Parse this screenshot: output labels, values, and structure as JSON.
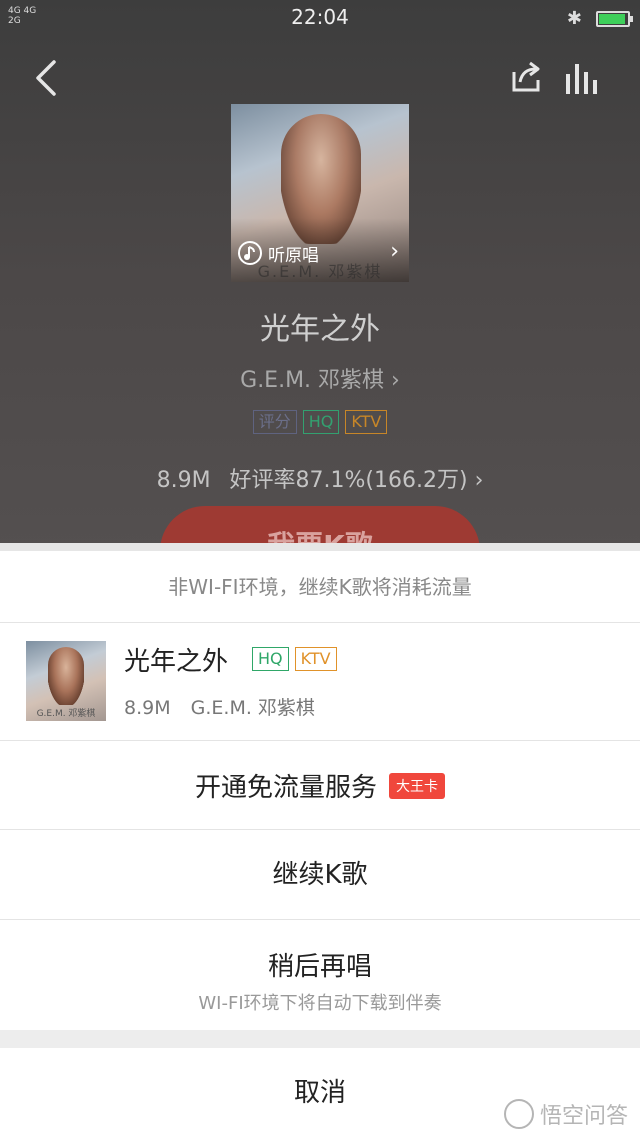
{
  "status_bar": {
    "network_left": "4G 4G",
    "network_left2": "2G",
    "time": "22:04",
    "battery_level": 0.85,
    "battery_color": "#3ecf5a"
  },
  "nav": {
    "back_icon": "chevron-left-icon",
    "share_icon": "share-icon",
    "equalizer_icon": "equalizer-icon"
  },
  "song": {
    "cover_caption": "G.E.M. 邓紫棋",
    "listen_label": "听原唱",
    "title": "光年之外",
    "artist": "G.E.M. 邓紫棋",
    "tags": [
      "评分",
      "HQ",
      "KTV"
    ],
    "plays": "8.9M",
    "rating": "好评率87.1%(166.2万)",
    "sing_button": "我要K歌"
  },
  "sheet": {
    "notice": "非WI-FI环境，继续K歌将消耗流量",
    "card": {
      "title": "光年之外",
      "tags": [
        "HQ",
        "KTV"
      ],
      "plays": "8.9M",
      "artist": "G.E.M. 邓紫棋",
      "thumb_caption": "G.E.M. 邓紫棋"
    },
    "free_traffic": "开通免流量服务",
    "free_traffic_badge": "大王卡",
    "continue": "继续K歌",
    "later": "稍后再唱",
    "later_sub": "WI-FI环境下将自动下载到伴奏",
    "cancel": "取消"
  },
  "watermark": "悟空问答",
  "colors": {
    "hq": "#2fa768",
    "ktv": "#e0922a",
    "badge": "#f0473c",
    "sing_button": "#9e3a33"
  }
}
